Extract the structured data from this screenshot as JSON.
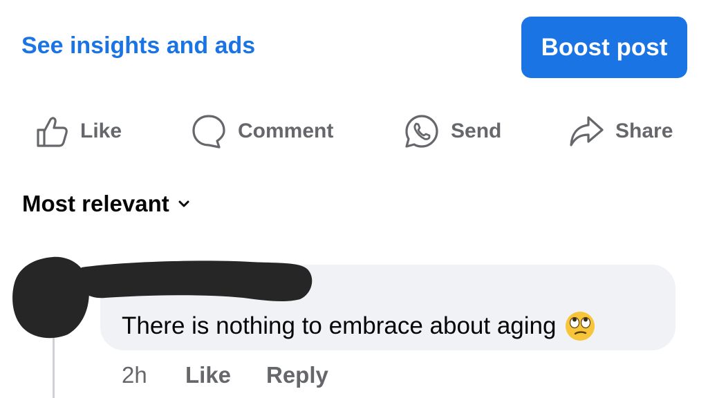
{
  "post": {
    "insights_link": "See insights and ads",
    "boost_label": "Boost post"
  },
  "actions": [
    {
      "label": "Like",
      "icon": "thumbs-up-icon"
    },
    {
      "label": "Comment",
      "icon": "comment-icon"
    },
    {
      "label": "Send",
      "icon": "whatsapp-icon"
    },
    {
      "label": "Share",
      "icon": "share-arrow-icon"
    }
  ],
  "comments_sort": {
    "label": "Most relevant",
    "icon": "chevron-down-icon"
  },
  "comment": {
    "text": "There is nothing to embrace about aging",
    "emoji": "face-with-rolling-eyes",
    "time": "2h",
    "like_label": "Like",
    "reply_label": "Reply"
  },
  "colors": {
    "accent": "#1b74e4",
    "muted_text": "#65676b",
    "bubble_bg": "#f0f2f5",
    "redaction": "#262626"
  }
}
